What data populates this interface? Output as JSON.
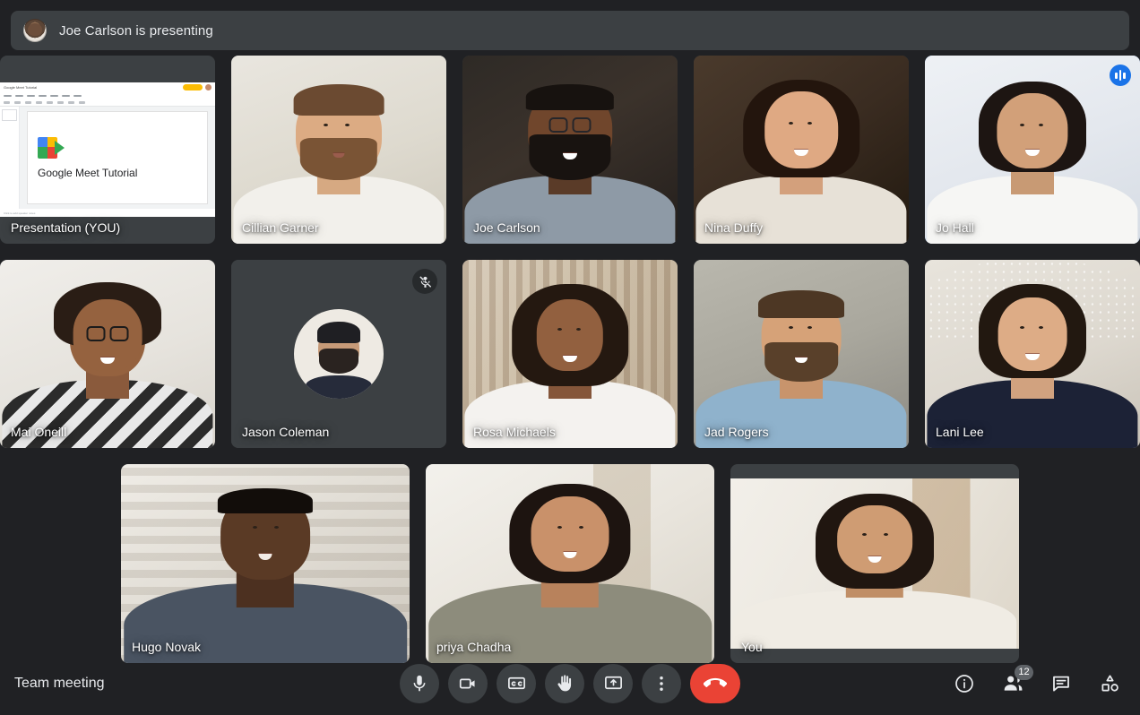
{
  "app": {
    "name": "Google Meet"
  },
  "banner": {
    "text": "Joe Carlson is presenting",
    "avatar_name": "joe-carlson-avatar"
  },
  "presentation": {
    "tile_label": "Presentation (YOU)",
    "slide_title": "Google Meet Tutorial",
    "doc_title": "Google Meet Tutorial",
    "share_button": "Share",
    "speaker_notes": "Click to add speaker notes"
  },
  "tiles": {
    "row_1": [
      {
        "name": "Presentation (YOU)",
        "type": "presentation",
        "muted": false,
        "speaking": false
      },
      {
        "name": "Cillian Garner",
        "type": "video",
        "muted": false,
        "speaking": false
      },
      {
        "name": "Joe Carlson",
        "type": "video",
        "muted": false,
        "speaking": false
      },
      {
        "name": "Nina Duffy",
        "type": "video",
        "muted": false,
        "speaking": false
      },
      {
        "name": "Jo Hall",
        "type": "video",
        "muted": false,
        "speaking": true
      }
    ],
    "row_2": [
      {
        "name": "Mai Oneill",
        "type": "video",
        "muted": false,
        "speaking": false
      },
      {
        "name": "Jason Coleman",
        "type": "avatar",
        "muted": true,
        "speaking": false
      },
      {
        "name": "Rosa Michaels",
        "type": "video",
        "muted": false,
        "speaking": false
      },
      {
        "name": "Jad Rogers",
        "type": "video",
        "muted": false,
        "speaking": false
      },
      {
        "name": "Lani Lee",
        "type": "video",
        "muted": false,
        "speaking": false
      }
    ],
    "row_3": [
      {
        "name": "Hugo Novak",
        "type": "video",
        "muted": false,
        "speaking": false
      },
      {
        "name": "priya Chadha",
        "type": "video",
        "muted": false,
        "speaking": false
      },
      {
        "name": "You",
        "type": "video",
        "muted": false,
        "speaking": false
      }
    ]
  },
  "bottom_bar": {
    "meeting_name": "Team meeting",
    "controls": [
      {
        "id": "microphone",
        "icon": "microphone-icon",
        "label": "Turn off microphone"
      },
      {
        "id": "camera",
        "icon": "video-camera-icon",
        "label": "Turn off camera"
      },
      {
        "id": "captions",
        "icon": "closed-captions-icon",
        "label": "Turn on captions"
      },
      {
        "id": "raise-hand",
        "icon": "raise-hand-icon",
        "label": "Raise hand"
      },
      {
        "id": "present",
        "icon": "present-screen-icon",
        "label": "Present now"
      },
      {
        "id": "more-options",
        "icon": "more-vertical-icon",
        "label": "More options"
      },
      {
        "id": "end-call",
        "icon": "end-call-icon",
        "label": "Leave call"
      }
    ],
    "right_controls": [
      {
        "id": "meeting-details",
        "icon": "info-icon",
        "label": "Meeting details",
        "badge": ""
      },
      {
        "id": "people",
        "icon": "people-icon",
        "label": "Show everyone",
        "badge": "12"
      },
      {
        "id": "chat",
        "icon": "chat-icon",
        "label": "Chat with everyone",
        "badge": ""
      },
      {
        "id": "activities",
        "icon": "activities-icon",
        "label": "Activities",
        "badge": ""
      }
    ]
  },
  "colors": {
    "background": "#202124",
    "tile": "#3c4043",
    "speaking_accent": "#5b9bf8",
    "speaking_badge": "#1a73e8",
    "end_call": "#ea4335",
    "text": "#e8eaed",
    "badge_gray": "#5f6368"
  }
}
